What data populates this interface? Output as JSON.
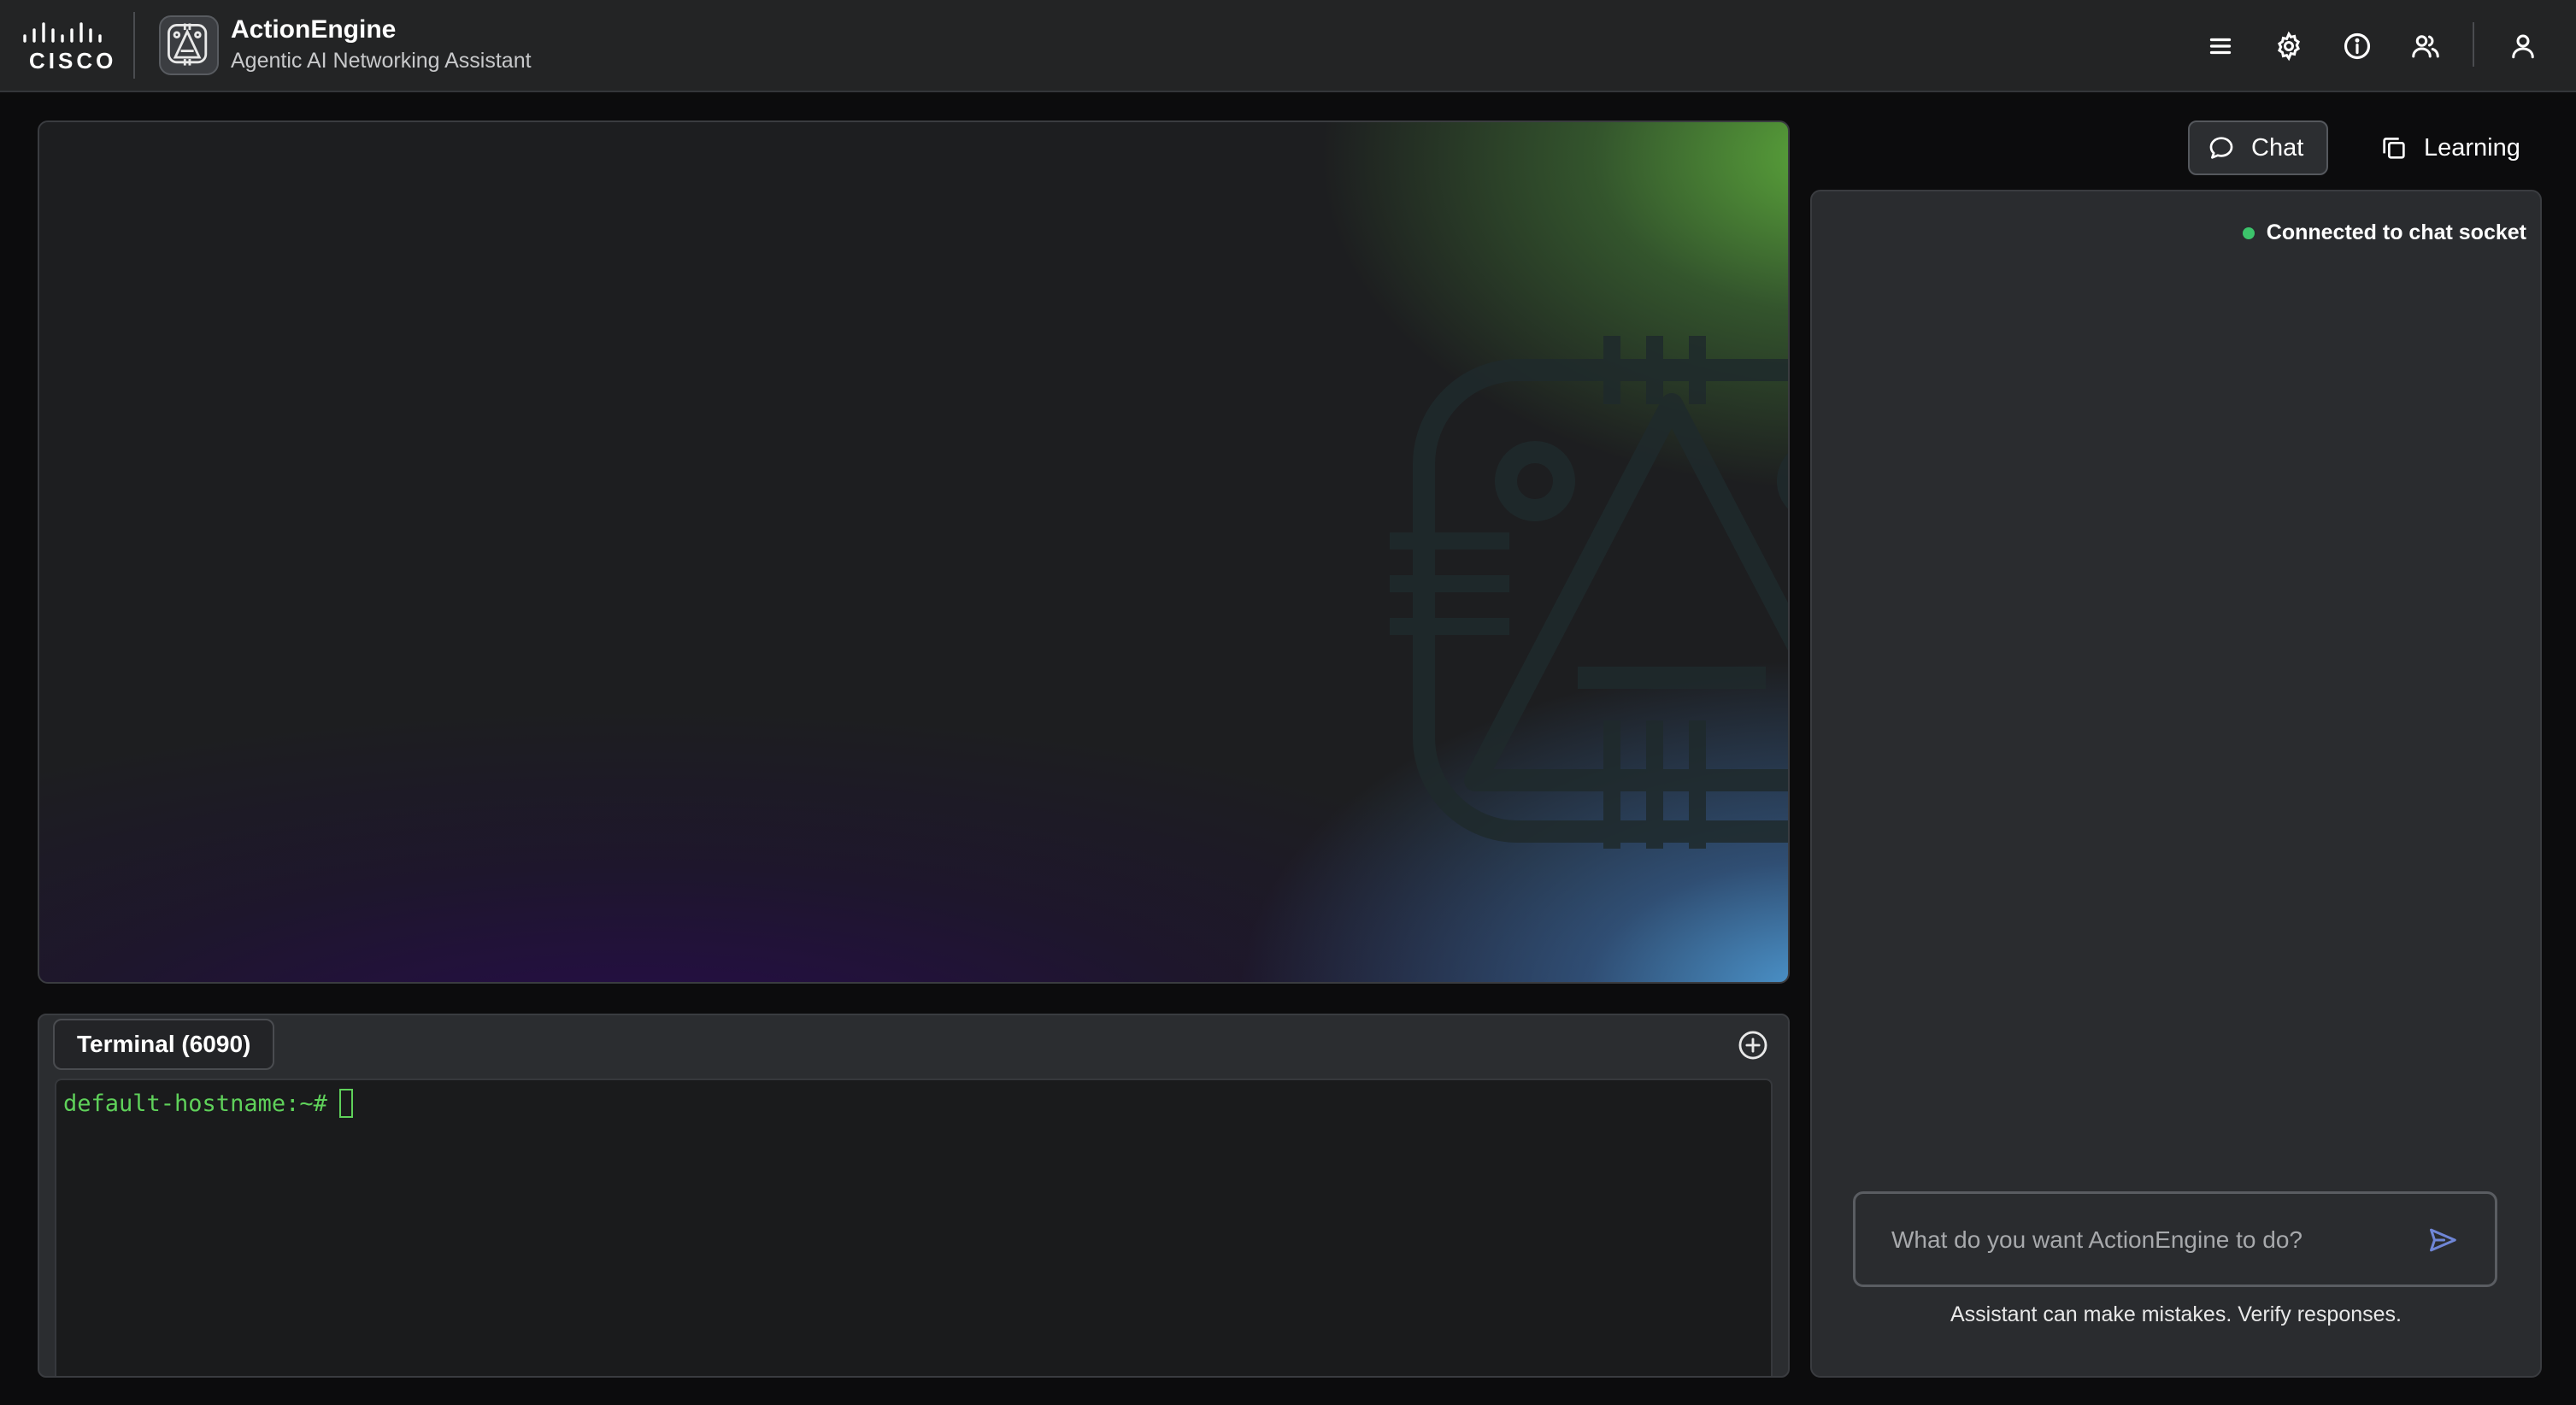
{
  "header": {
    "brand_wordmark": "CISCO",
    "app_title": "ActionEngine",
    "app_subtitle": "Agentic AI Networking Assistant",
    "icons": [
      "menu-icon",
      "settings-gear-icon",
      "info-icon",
      "users-icon",
      "user-profile-icon"
    ]
  },
  "terminal": {
    "tab_label": "Terminal (6090)",
    "prompt": "default-hostname:~#"
  },
  "modes": {
    "chat_label": "Chat",
    "learning_label": "Learning",
    "active": "Chat"
  },
  "chat": {
    "status_text": "Connected to chat socket",
    "status_color": "#3cc46b",
    "input_placeholder": "What do you want ActionEngine to do?",
    "input_value": "",
    "disclaimer": "Assistant can make mistakes. Verify responses."
  },
  "colors": {
    "terminal_text": "#5fd15a",
    "send_icon": "#6f86d6",
    "hero_green": "#5faf3c",
    "hero_blue": "#50a0dc",
    "hero_purple": "#280a50"
  }
}
